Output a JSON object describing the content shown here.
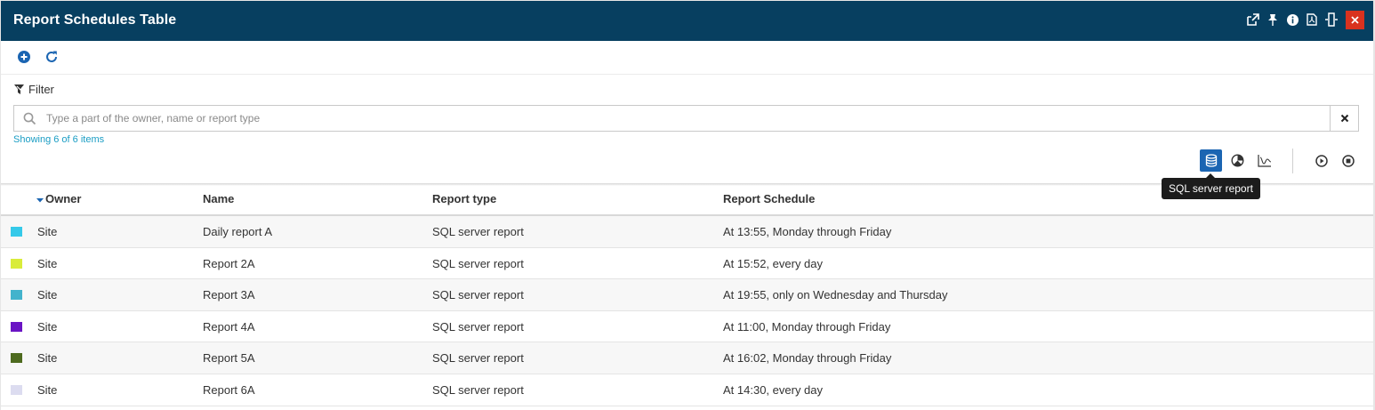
{
  "window": {
    "title": "Report Schedules Table",
    "close_label": "×"
  },
  "toolbar": {
    "add_icon": "plus-circle-icon",
    "refresh_icon": "refresh-icon"
  },
  "filter": {
    "label": "Filter",
    "placeholder": "Type a part of the owner, name or report type",
    "value": "",
    "showing": "Showing 6 of 6 items"
  },
  "view": {
    "tooltip": "SQL server report",
    "active": "sql-server-report"
  },
  "table": {
    "columns": [
      "Owner",
      "Name",
      "Report type",
      "Report Schedule"
    ],
    "sort_column": "Owner",
    "rows": [
      {
        "color": "#35c9e9",
        "owner": "Site",
        "name": "Daily report A",
        "type": "SQL server report",
        "schedule": "At 13:55, Monday through Friday"
      },
      {
        "color": "#d9ec3b",
        "owner": "Site",
        "name": "Report 2A",
        "type": "SQL server report",
        "schedule": "At 15:52, every day"
      },
      {
        "color": "#43b3cc",
        "owner": "Site",
        "name": "Report 3A",
        "type": "SQL server report",
        "schedule": "At 19:55, only on Wednesday and Thursday"
      },
      {
        "color": "#6a14c4",
        "owner": "Site",
        "name": "Report 4A",
        "type": "SQL server report",
        "schedule": "At 11:00, Monday through Friday"
      },
      {
        "color": "#4e6b1f",
        "owner": "Site",
        "name": "Report 5A",
        "type": "SQL server report",
        "schedule": "At 16:02, Monday through Friday"
      },
      {
        "color": "#dcdcf0",
        "owner": "Site",
        "name": "Report 6A",
        "type": "SQL server report",
        "schedule": "At 14:30, every day"
      }
    ]
  },
  "colors": {
    "titlebar": "#073f60",
    "accent": "#1b65b2",
    "close": "#d9321f",
    "link": "#1a9dc4"
  }
}
